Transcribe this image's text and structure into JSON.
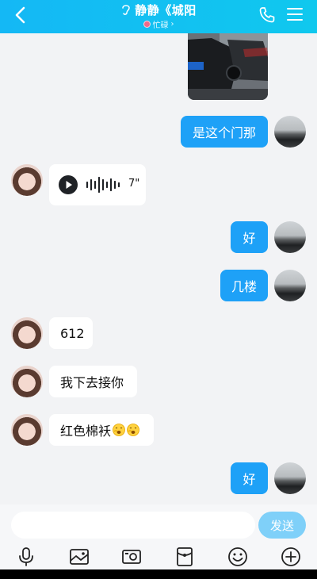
{
  "header": {
    "title": "静静《城阳",
    "status": "忙碌",
    "status_chevron": "›"
  },
  "messages": [
    {
      "sender": "self",
      "type": "image"
    },
    {
      "sender": "self",
      "type": "text",
      "text": "是这个门那"
    },
    {
      "sender": "peer",
      "type": "voice",
      "duration": "7\""
    },
    {
      "sender": "self",
      "type": "text",
      "text": "好"
    },
    {
      "sender": "self",
      "type": "text",
      "text": "几楼"
    },
    {
      "sender": "peer",
      "type": "text",
      "text": "612"
    },
    {
      "sender": "peer",
      "type": "text",
      "text": "我下去接你"
    },
    {
      "sender": "peer",
      "type": "text",
      "text": "红色棉袄"
    },
    {
      "sender": "self",
      "type": "text",
      "text": "好"
    }
  ],
  "input": {
    "placeholder": "",
    "send_label": "发送"
  },
  "toolbar": [
    "mic-icon",
    "image-icon",
    "camera-icon",
    "red-packet-icon",
    "emoji-icon",
    "plus-icon"
  ],
  "colors": {
    "header": "#14b8f5",
    "self_bubble": "#1ea1f7",
    "peer_bubble": "#ffffff",
    "background": "#f2f3f5",
    "send_button": "#7fd0f9"
  }
}
